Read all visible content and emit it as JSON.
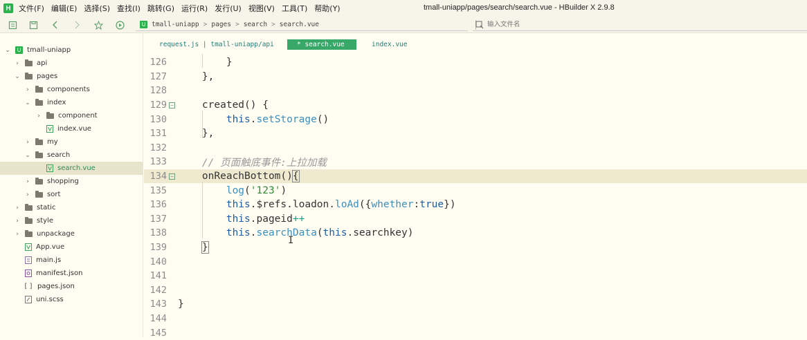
{
  "menubar": {
    "logo": "H",
    "items": [
      "文件(F)",
      "编辑(E)",
      "选择(S)",
      "查找(I)",
      "跳转(G)",
      "运行(R)",
      "发行(U)",
      "视图(V)",
      "工具(T)",
      "帮助(Y)"
    ],
    "title": "tmall-uniapp/pages/search/search.vue - HBuilder X 2.9.8"
  },
  "toolbar": {
    "icons": [
      "file-list-icon",
      "save-icon",
      "back-icon",
      "forward-icon",
      "star-icon",
      "run-icon"
    ],
    "breadcrumb": {
      "project_icon": "U",
      "items": [
        "tmall-uniapp",
        "pages",
        "search",
        "search.vue"
      ],
      "separator": ">"
    },
    "file_search": {
      "placeholder": "输入文件名"
    }
  },
  "sidebar": {
    "items": [
      {
        "label": "tmall-uniapp",
        "type": "project",
        "expanded": true
      },
      {
        "label": "api",
        "type": "folder",
        "expanded": false
      },
      {
        "label": "pages",
        "type": "folder",
        "expanded": true
      },
      {
        "label": "components",
        "type": "folder",
        "expanded": false
      },
      {
        "label": "index",
        "type": "folder",
        "expanded": true
      },
      {
        "label": "component",
        "type": "folder",
        "expanded": false
      },
      {
        "label": "index.vue",
        "type": "vue-file"
      },
      {
        "label": "my",
        "type": "folder",
        "expanded": false
      },
      {
        "label": "search",
        "type": "folder",
        "expanded": true
      },
      {
        "label": "search.vue",
        "type": "vue-file",
        "selected": true
      },
      {
        "label": "shopping",
        "type": "folder",
        "expanded": false
      },
      {
        "label": "sort",
        "type": "folder",
        "expanded": false
      },
      {
        "label": "static",
        "type": "folder",
        "expanded": false
      },
      {
        "label": "style",
        "type": "folder",
        "expanded": false
      },
      {
        "label": "unpackage",
        "type": "folder",
        "expanded": false
      },
      {
        "label": "App.vue",
        "type": "vue-file"
      },
      {
        "label": "main.js",
        "type": "js-file"
      },
      {
        "label": "manifest.json",
        "type": "manifest-file"
      },
      {
        "label": "pages.json",
        "type": "json-file",
        "icon_text": "[ ]"
      },
      {
        "label": "uni.scss",
        "type": "scss-file"
      }
    ]
  },
  "tabs": [
    {
      "label": "request.js | tmall-uniapp/api",
      "active": false
    },
    {
      "label": "* search.vue",
      "active": true
    },
    {
      "label": "index.vue",
      "active": false
    }
  ],
  "editor": {
    "lines": [
      {
        "n": "126",
        "fold": false,
        "tokens": [
          {
            "t": "        }",
            "c": "plain"
          }
        ]
      },
      {
        "n": "127",
        "fold": false,
        "tokens": [
          {
            "t": "    },",
            "c": "plain"
          }
        ]
      },
      {
        "n": "128",
        "fold": false,
        "tokens": []
      },
      {
        "n": "129",
        "fold": true,
        "tokens": [
          {
            "t": "    created",
            "c": "plain"
          },
          {
            "t": "() {",
            "c": "plain"
          }
        ]
      },
      {
        "n": "130",
        "fold": false,
        "tokens": [
          {
            "t": "        ",
            "c": "plain"
          },
          {
            "t": "this",
            "c": "key"
          },
          {
            "t": ".",
            "c": "plain"
          },
          {
            "t": "setStorage",
            "c": "fn"
          },
          {
            "t": "()",
            "c": "plain"
          }
        ]
      },
      {
        "n": "131",
        "fold": false,
        "tokens": [
          {
            "t": "    },",
            "c": "plain"
          }
        ]
      },
      {
        "n": "132",
        "fold": false,
        "tokens": []
      },
      {
        "n": "133",
        "fold": false,
        "tokens": [
          {
            "t": "    // 页面触底事件:上拉加载",
            "c": "com"
          }
        ]
      },
      {
        "n": "134",
        "fold": true,
        "current": true,
        "tokens": [
          {
            "t": "    onReachBottom",
            "c": "plain"
          },
          {
            "t": "()",
            "c": "plain"
          },
          {
            "t": "{",
            "c": "bracket"
          }
        ]
      },
      {
        "n": "135",
        "fold": false,
        "tokens": [
          {
            "t": "        ",
            "c": "plain"
          },
          {
            "t": "log",
            "c": "fn"
          },
          {
            "t": "(",
            "c": "plain"
          },
          {
            "t": "'123'",
            "c": "str"
          },
          {
            "t": ")",
            "c": "plain"
          }
        ]
      },
      {
        "n": "136",
        "fold": false,
        "tokens": [
          {
            "t": "        ",
            "c": "plain"
          },
          {
            "t": "this",
            "c": "key"
          },
          {
            "t": ".$refs.loadon.",
            "c": "plain"
          },
          {
            "t": "loAd",
            "c": "fn"
          },
          {
            "t": "({",
            "c": "plain"
          },
          {
            "t": "whether",
            "c": "fn"
          },
          {
            "t": ":",
            "c": "plain"
          },
          {
            "t": "true",
            "c": "bool"
          },
          {
            "t": "})",
            "c": "plain"
          }
        ]
      },
      {
        "n": "137",
        "fold": false,
        "tokens": [
          {
            "t": "        ",
            "c": "plain"
          },
          {
            "t": "this",
            "c": "key"
          },
          {
            "t": ".pageid",
            "c": "plain"
          },
          {
            "t": "++",
            "c": "op"
          }
        ]
      },
      {
        "n": "138",
        "fold": false,
        "tokens": [
          {
            "t": "        ",
            "c": "plain"
          },
          {
            "t": "this",
            "c": "key"
          },
          {
            "t": ".",
            "c": "plain"
          },
          {
            "t": "searchData",
            "c": "fn"
          },
          {
            "t": "(",
            "c": "plain"
          },
          {
            "t": "this",
            "c": "key"
          },
          {
            "t": ".searchkey)",
            "c": "plain"
          }
        ]
      },
      {
        "n": "139",
        "fold": false,
        "tokens": [
          {
            "t": "    ",
            "c": "plain"
          },
          {
            "t": "}",
            "c": "bracket"
          }
        ]
      },
      {
        "n": "140",
        "fold": false,
        "tokens": []
      },
      {
        "n": "141",
        "fold": false,
        "tokens": []
      },
      {
        "n": "142",
        "fold": false,
        "tokens": []
      },
      {
        "n": "143",
        "fold": false,
        "tokens": [
          {
            "t": "}",
            "c": "plain"
          }
        ]
      },
      {
        "n": "144",
        "fold": false,
        "tokens": []
      },
      {
        "n": "145",
        "fold": false,
        "tokens": []
      }
    ],
    "mouse_cursor": "I"
  }
}
